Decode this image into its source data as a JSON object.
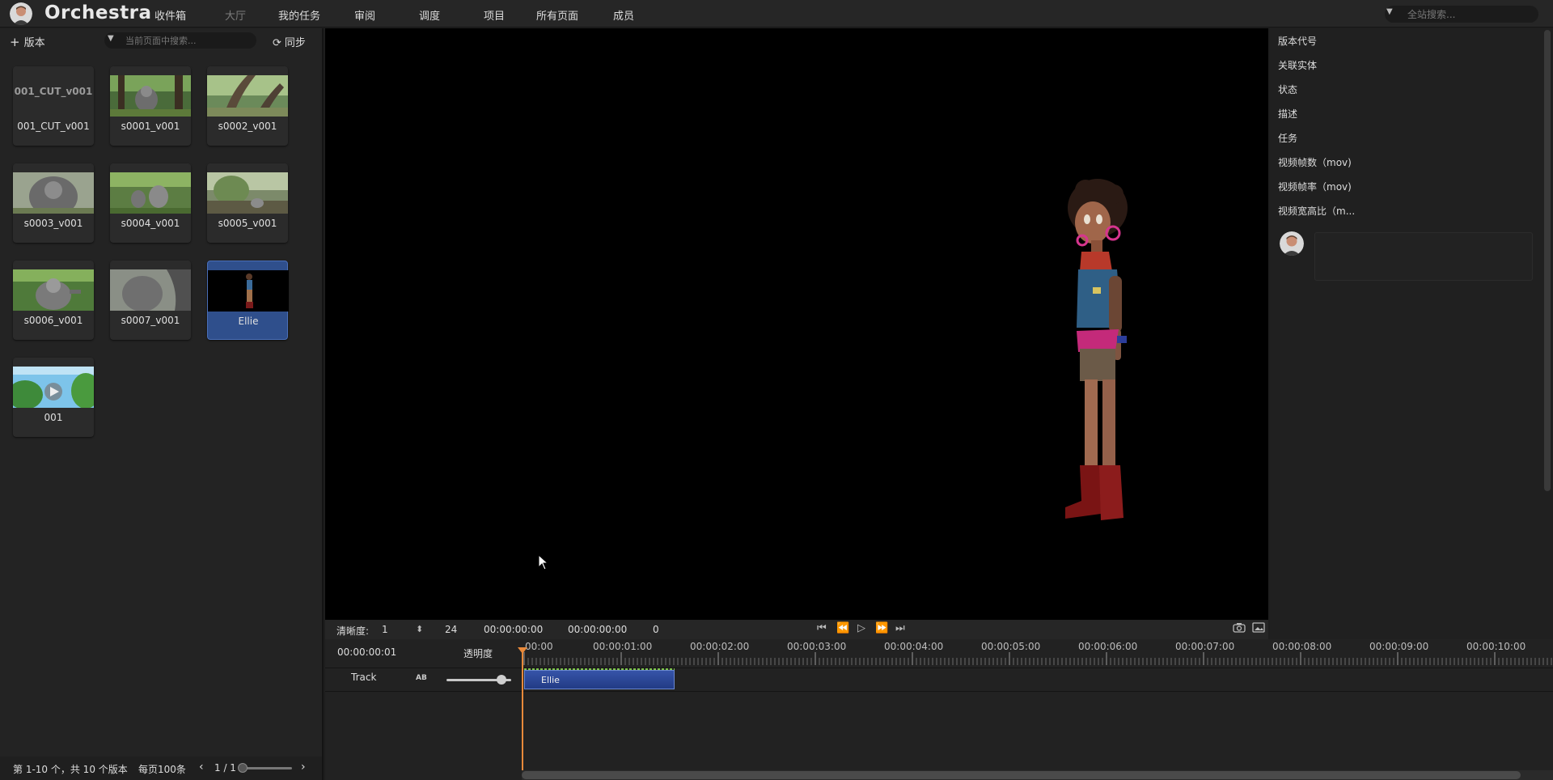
{
  "app": {
    "title": "Orchestra"
  },
  "nav": {
    "items": [
      {
        "label": "收件箱",
        "active": true
      },
      {
        "label": "大厅",
        "active": false
      },
      {
        "label": "我的任务",
        "active": true
      },
      {
        "label": "审阅",
        "active": true
      },
      {
        "label": "调度",
        "active": true
      },
      {
        "label": "项目",
        "active": true
      },
      {
        "label": "所有页面",
        "active": true
      },
      {
        "label": "成员",
        "active": true
      }
    ],
    "global_search_placeholder": "全站搜索..."
  },
  "left_panel": {
    "add_version_label": "版本",
    "search_placeholder": "当前页面中搜索...",
    "sync_label": "同步",
    "cards": [
      {
        "caption": "001_CUT_v001",
        "thumb_text": "001_CUT_v001",
        "thumb": "text",
        "selected": false
      },
      {
        "caption": "s0001_v001",
        "thumb": "forest-gorilla",
        "selected": false
      },
      {
        "caption": "s0002_v001",
        "thumb": "forest-trunk",
        "selected": false
      },
      {
        "caption": "s0003_v001",
        "thumb": "gorilla-close",
        "selected": false
      },
      {
        "caption": "s0004_v001",
        "thumb": "forest-group",
        "selected": false
      },
      {
        "caption": "s0005_v001",
        "thumb": "forest-ground",
        "selected": false
      },
      {
        "caption": "s0006_v001",
        "thumb": "gorilla-hand",
        "selected": false
      },
      {
        "caption": "s0007_v001",
        "thumb": "gorilla-grey",
        "selected": false
      },
      {
        "caption": "Ellie",
        "thumb": "character-dark",
        "selected": true
      },
      {
        "caption": "001",
        "thumb": "sky-video",
        "selected": false
      }
    ],
    "footer": {
      "summary": "第 1-10 个，共 10 个版本",
      "per_page": "每页100条",
      "prev_icon": "chevron-left-icon",
      "position": "1 / 1",
      "next_icon": "chevron-right-icon"
    }
  },
  "controls": {
    "quality_label": "清晰度:",
    "quality_value": "1",
    "fps": "24",
    "current_time": "00:00:00:00",
    "duration": "00:00:00:00",
    "frame": "0",
    "buttons": [
      "skip-start-icon",
      "rewind-icon",
      "play-icon",
      "fast-forward-icon",
      "skip-end-icon"
    ],
    "right_icons": [
      "camera-icon",
      "image-icon"
    ]
  },
  "timeline": {
    "time": "00:00:00:01",
    "opacity_label": "透明度",
    "track_label": "Track",
    "track_icon_text": "AB",
    "opacity": 0.85,
    "ticks": [
      "00:00",
      "00:00:01:00",
      "00:00:02:00",
      "00:00:03:00",
      "00:00:04:00",
      "00:00:05:00",
      "00:00:06:00",
      "00:00:07:00",
      "00:00:08:00",
      "00:00:09:00",
      "00:00:10:00"
    ],
    "clip": {
      "label": "Ellie"
    }
  },
  "right_panel": {
    "fields": [
      "版本代号",
      "关联实体",
      "状态",
      "描述",
      "任务",
      "视频帧数（mov)",
      "视频帧率（mov)",
      "视频宽高比（m..."
    ]
  },
  "colors": {
    "accent": "#2f4f8c",
    "playhead": "#e8893a",
    "clip": "#2a449a"
  }
}
